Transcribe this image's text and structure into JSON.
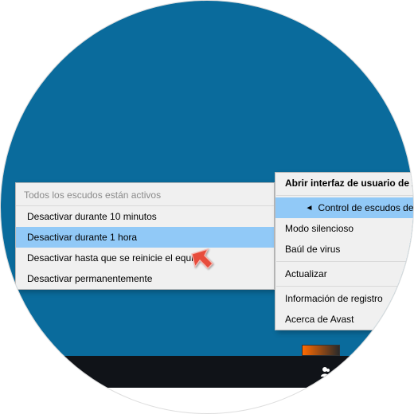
{
  "submenu": {
    "header": "Todos los escudos están activos",
    "items": [
      {
        "label": "Desactivar durante 10 minutos",
        "highlight": false
      },
      {
        "label": "Desactivar durante 1 hora",
        "highlight": true
      },
      {
        "label": "Desactivar hasta que se reinicie el equipo",
        "highlight": false
      },
      {
        "label": "Desactivar permanentemente",
        "highlight": false
      }
    ]
  },
  "mainmenu": {
    "items": [
      {
        "label": "Abrir interfaz de usuario de Avast",
        "bold": true,
        "highlight": false
      },
      {
        "label": "Control de escudos de Avast",
        "bold": false,
        "highlight": true,
        "hasSubmenu": true
      },
      {
        "label": "Modo silencioso",
        "bold": false,
        "highlight": false
      },
      {
        "label": "Baúl de virus",
        "bold": false,
        "highlight": false
      },
      {
        "label": "Actualizar",
        "bold": false,
        "highlight": false
      },
      {
        "label": "Información de registro",
        "bold": false,
        "highlight": false
      },
      {
        "label": "Acerca de Avast",
        "bold": false,
        "highlight": false
      }
    ]
  },
  "taskbar": {
    "language": "ES"
  },
  "colors": {
    "desktop": "#0a6b9c",
    "highlight": "#91c9f7",
    "taskbar": "#101318"
  }
}
